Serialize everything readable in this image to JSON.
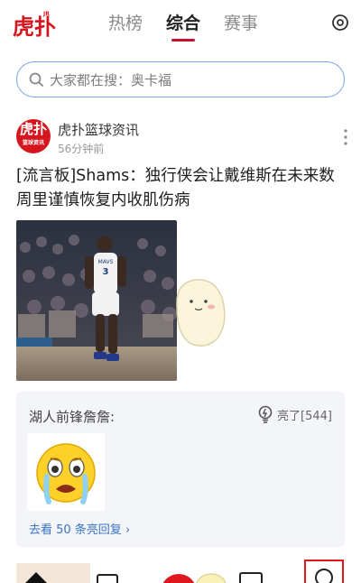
{
  "header": {
    "logo_text": "虎扑",
    "tabs": [
      {
        "label": "热榜",
        "active": false
      },
      {
        "label": "综合",
        "active": true
      },
      {
        "label": "赛事",
        "active": false
      }
    ]
  },
  "search": {
    "placeholder": "大家都在搜：奥卡福"
  },
  "post": {
    "author": "虎扑篮球资讯",
    "avatar_text": "虎扑",
    "avatar_sub": "篮球资讯",
    "time": "56分钟前",
    "title": "[流言板]Shams：独行侠会让戴维斯在未来数周里谨慎恢复内收肌伤病",
    "jersey_number": "3",
    "jersey_team": "MAVS"
  },
  "comment": {
    "user": "湖人前锋詹詹:",
    "like_label": "亮了[544]",
    "more_replies": "去看 50 条亮回复"
  },
  "colors": {
    "brand_red": "#c8102e",
    "search_border": "#7aa7dc",
    "link_blue": "#3a73c4"
  },
  "icons": {
    "settings": "settings-icon",
    "search": "search-icon",
    "more": "more-vertical-icon",
    "like": "lightbulb-icon"
  }
}
